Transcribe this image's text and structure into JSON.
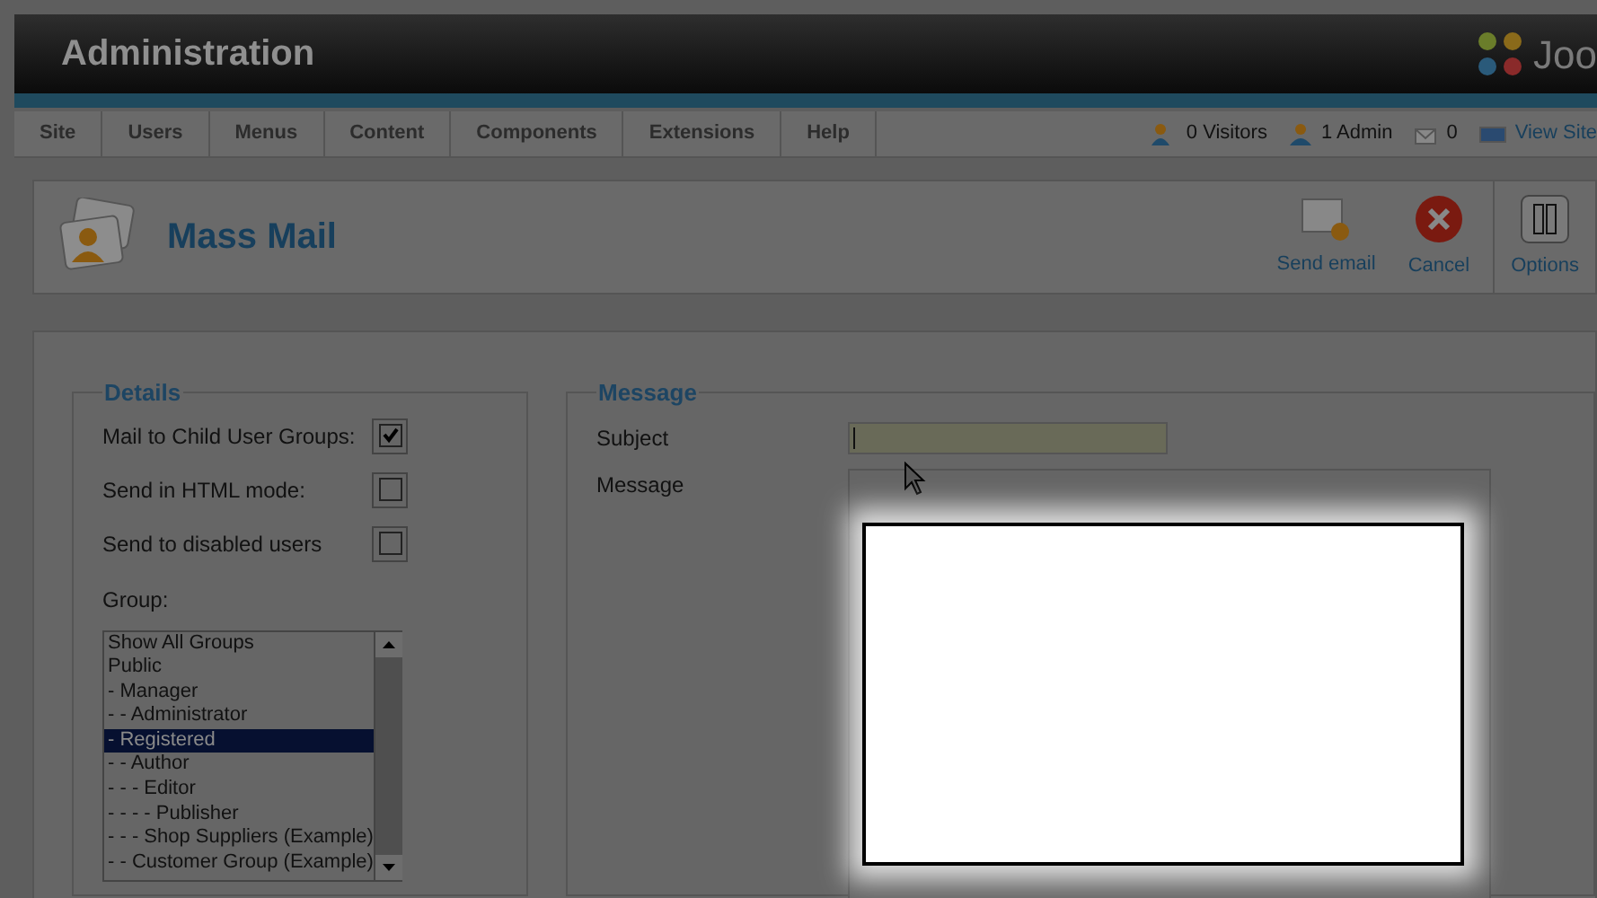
{
  "header": {
    "title": "Administration",
    "logo_text": "Joo"
  },
  "menu": [
    {
      "label": "Site"
    },
    {
      "label": "Users"
    },
    {
      "label": "Menus"
    },
    {
      "label": "Content"
    },
    {
      "label": "Components"
    },
    {
      "label": "Extensions"
    },
    {
      "label": "Help"
    }
  ],
  "status": [
    {
      "kind": "visitors",
      "label": "0 Visitors"
    },
    {
      "kind": "admin",
      "label": "1 Admin"
    },
    {
      "kind": "messages",
      "label": "0"
    },
    {
      "kind": "site",
      "label": "View Site"
    }
  ],
  "toolbar": {
    "title": "Mass Mail",
    "buttons": [
      {
        "kind": "send",
        "label": "Send email"
      },
      {
        "kind": "cancel",
        "label": "Cancel"
      },
      {
        "kind": "options",
        "label": "Options"
      }
    ]
  },
  "details": {
    "legend": "Details",
    "checkboxes": [
      {
        "label": "Mail to Child User Groups:",
        "checked": true
      },
      {
        "label": "Send in HTML mode:",
        "checked": false
      },
      {
        "label": "Send to disabled users",
        "checked": false
      }
    ],
    "group_label": "Group:",
    "groups": [
      {
        "label": "Show All Groups",
        "selected": false
      },
      {
        "label": "Public",
        "selected": false
      },
      {
        "label": "- Manager",
        "selected": false
      },
      {
        "label": "- - Administrator",
        "selected": false
      },
      {
        "label": "- Registered",
        "selected": true
      },
      {
        "label": "- - Author",
        "selected": false
      },
      {
        "label": "- - - Editor",
        "selected": false
      },
      {
        "label": "- - - - Publisher",
        "selected": false
      },
      {
        "label": "- - - Shop Suppliers (Example)",
        "selected": false
      },
      {
        "label": "- - Customer Group (Example)",
        "selected": false
      }
    ]
  },
  "message": {
    "legend": "Message",
    "subject_label": "Subject",
    "message_label": "Message"
  }
}
